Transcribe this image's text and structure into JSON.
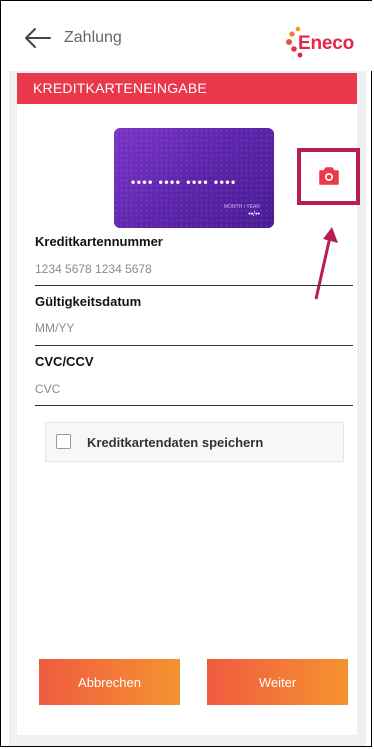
{
  "header": {
    "title": "Zahlung",
    "back_icon": "arrow-left-icon",
    "logo_text": "Eneco"
  },
  "panel": {
    "title": "KREDITKARTENEINGABE"
  },
  "card_image": {
    "number_mask": "•••• •••• •••• ••••",
    "valid_label": "MONTH / YEAR",
    "expiry_mask": "••/••"
  },
  "camera": {
    "icon": "camera-icon"
  },
  "fields": {
    "card_number": {
      "label": "Kreditkartennummer",
      "placeholder": "1234 5678 1234 5678",
      "value": ""
    },
    "expiry": {
      "label": "Gültigkeitsdatum",
      "placeholder": "MM/YY",
      "value": ""
    },
    "cvc": {
      "label": "CVC/CCV",
      "placeholder": "CVC",
      "value": ""
    }
  },
  "save_card": {
    "label": "Kreditkartendaten speichern",
    "checked": false
  },
  "buttons": {
    "cancel": "Abbrechen",
    "next": "Weiter"
  },
  "colors": {
    "accent_red": "#e8384a",
    "highlight": "#b6204e",
    "button_gradient_start": "#ef5b40",
    "button_gradient_end": "#f5932f",
    "card_purple": "#6a2cbc"
  }
}
